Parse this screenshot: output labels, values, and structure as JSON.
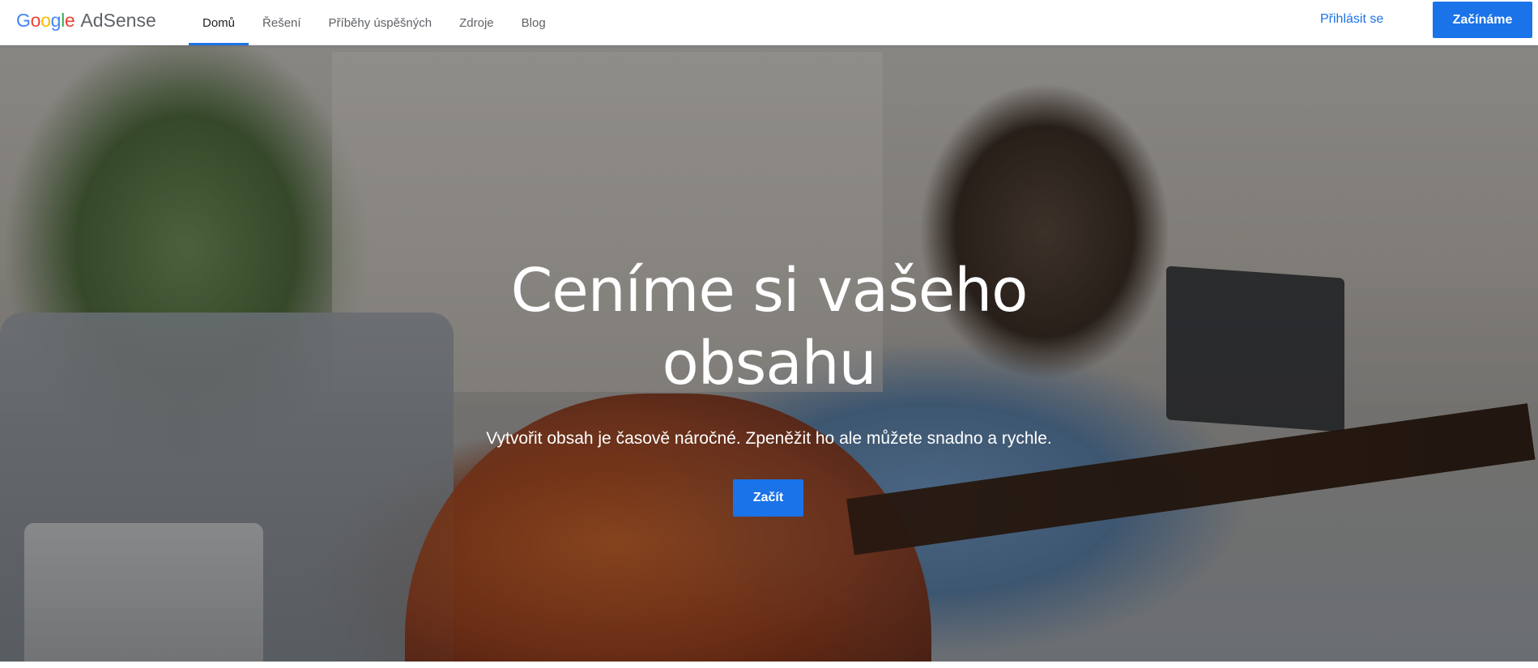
{
  "header": {
    "logo": {
      "google": "Google",
      "product": "AdSense"
    },
    "nav": [
      {
        "label": "Domů",
        "active": true
      },
      {
        "label": "Řešení",
        "active": false
      },
      {
        "label": "Příběhy úspěšných",
        "active": false
      },
      {
        "label": "Zdroje",
        "active": false
      },
      {
        "label": "Blog",
        "active": false
      }
    ],
    "signin_label": "Přihlásit se",
    "cta_label": "Začínáme"
  },
  "hero": {
    "title_line1": "Ceníme si vašeho",
    "title_line2": "obsahu",
    "subtitle": "Vytvořit obsah je časově náročné. Zpeněžit ho ale můžete snadno a rychle.",
    "button_label": "Začít"
  },
  "colors": {
    "accent": "#1a73e8",
    "nav_text": "#5f6368",
    "active_text": "#202124"
  }
}
